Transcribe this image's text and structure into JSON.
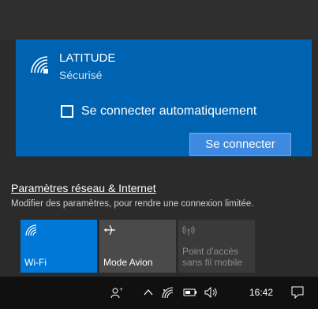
{
  "network": {
    "name": "LATITUDE",
    "status": "Sécurisé",
    "auto_connect_label": "Se connecter automatiquement",
    "auto_connect_checked": false,
    "connect_button": "Se connecter"
  },
  "settings": {
    "link": "Paramètres réseau & Internet",
    "description": "Modifier des paramètres, pour rendre une connexion limitée."
  },
  "tiles": [
    {
      "label": "Wi-Fi",
      "icon": "wifi-icon",
      "active": true
    },
    {
      "label": "Mode Avion",
      "icon": "airplane-icon",
      "active": false
    },
    {
      "label": "Point d'accès sans fil mobile",
      "line1": "Point d'accès",
      "line2": "sans fil mobile",
      "icon": "hotspot-icon",
      "disabled": true
    }
  ],
  "taskbar": {
    "clock": "16:42",
    "icons": [
      "people-icon",
      "chevron-up-icon",
      "wifi-icon",
      "battery-icon",
      "volume-icon",
      "notification-icon"
    ]
  },
  "colors": {
    "accent": "#0063b1",
    "tile_active": "#0078d7",
    "button": "#3d8ae0"
  }
}
